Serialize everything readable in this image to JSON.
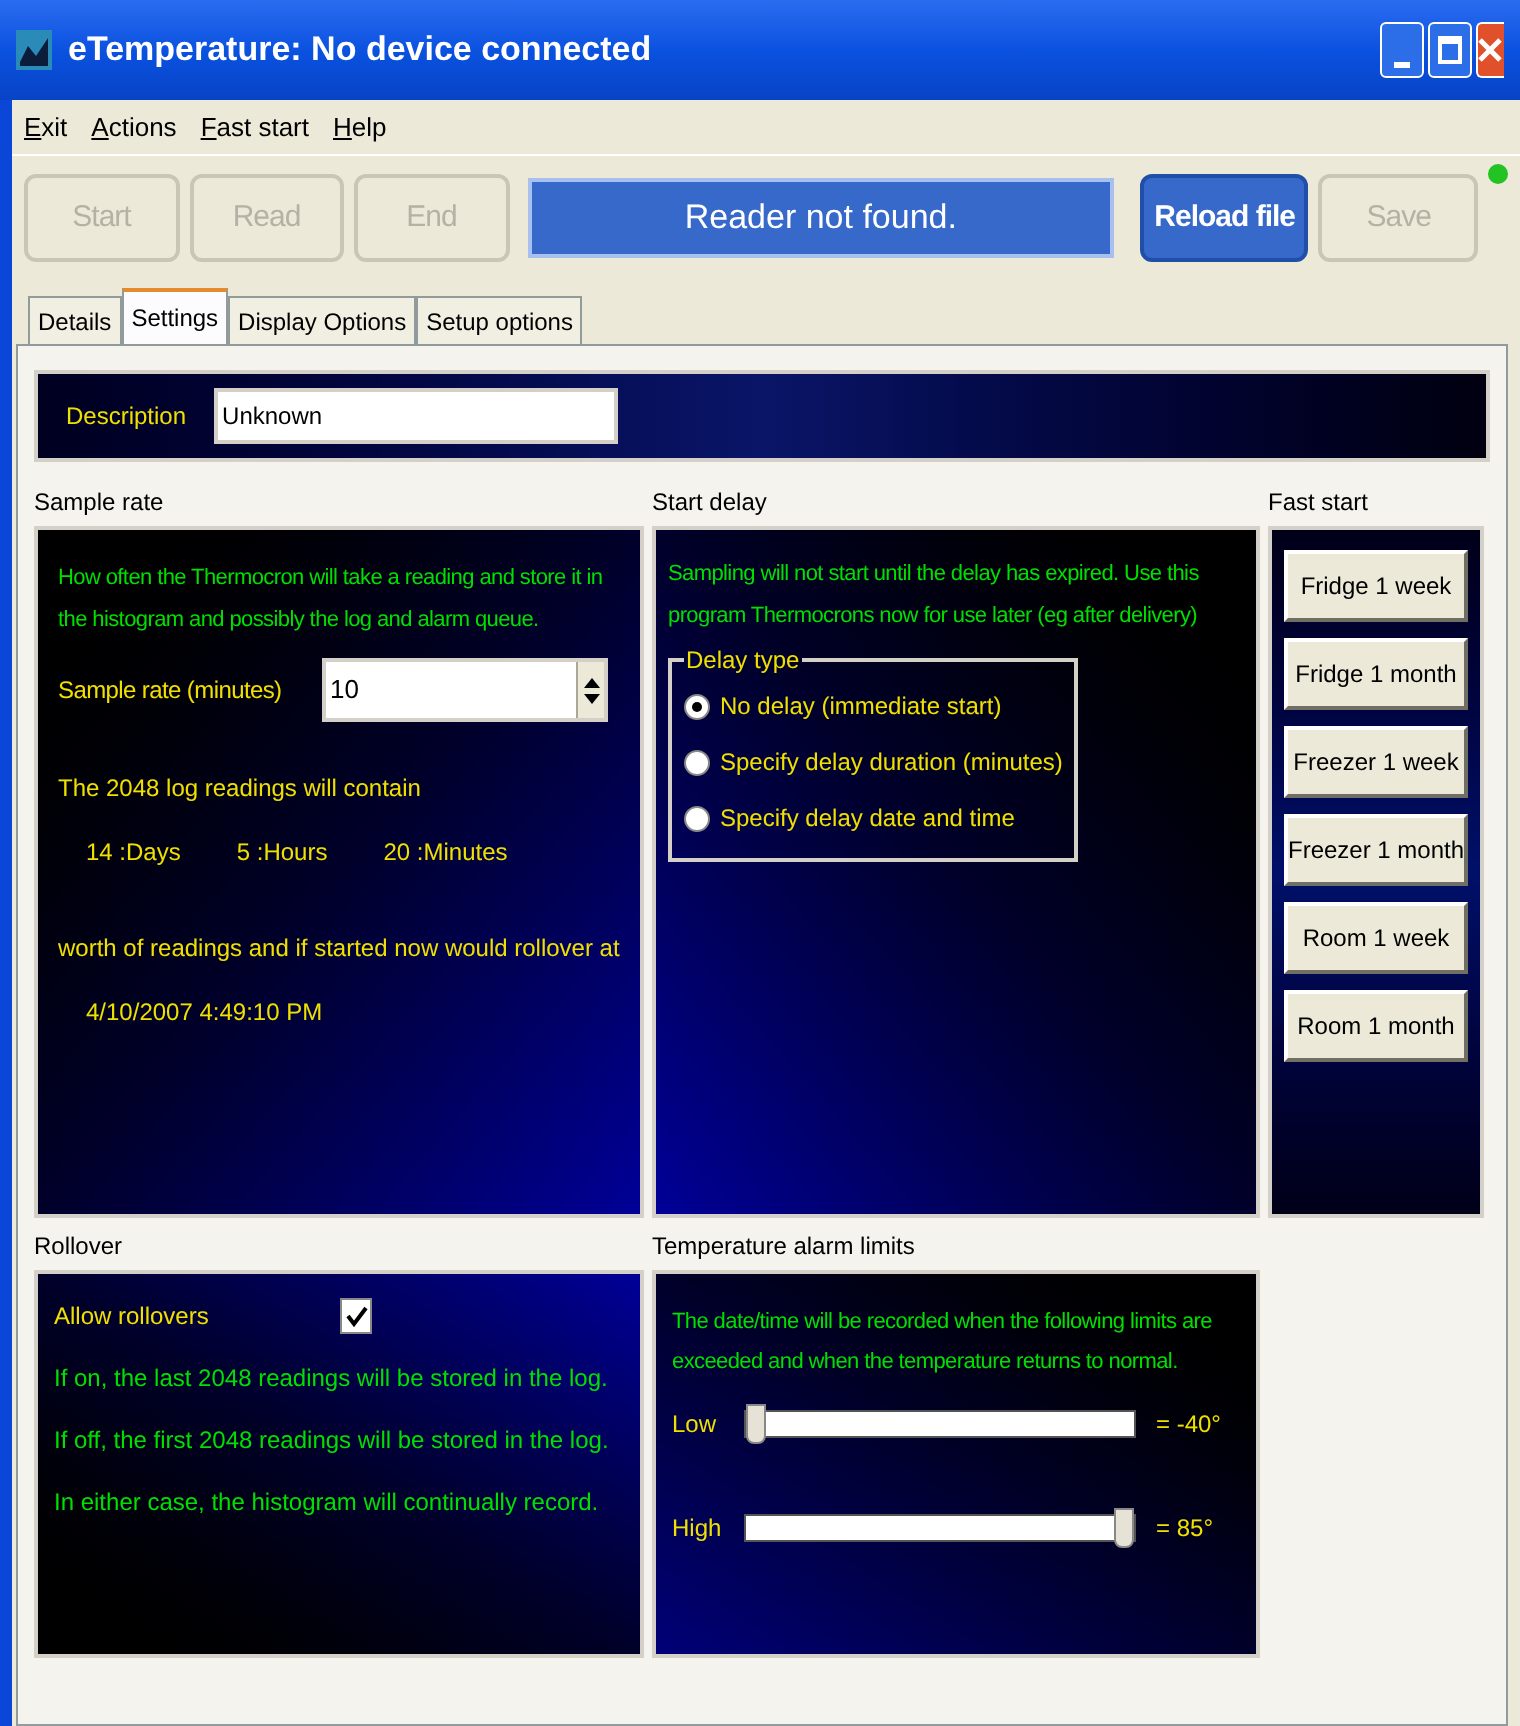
{
  "window": {
    "title": "eTemperature: No device connected"
  },
  "menu": [
    "Exit",
    "Actions",
    "Fast start",
    "Help"
  ],
  "toolbar": {
    "buttons_left": [
      {
        "label": "Start",
        "disabled": true
      },
      {
        "label": "Read",
        "disabled": true
      },
      {
        "label": "End",
        "disabled": true
      }
    ],
    "status": "Reader not found.",
    "buttons_right": [
      {
        "label": "Reload file",
        "disabled": false
      },
      {
        "label": "Save",
        "disabled": true
      }
    ],
    "indicator": {
      "on": true
    }
  },
  "tabs": [
    {
      "label": "Details",
      "selected": false
    },
    {
      "label": "Settings",
      "selected": true
    },
    {
      "label": "Display Options",
      "selected": false
    },
    {
      "label": "Setup options",
      "selected": false
    }
  ],
  "description": {
    "label": "Description",
    "value": "Unknown"
  },
  "sample_rate": {
    "title": "Sample rate",
    "intro": "How often the Thermocron will take a reading and store it in the histogram and possibly the log and alarm queue.",
    "field_label": "Sample rate (minutes)",
    "value": "10",
    "summary": "The 2048 log readings will contain",
    "durations": [
      "14 :Days",
      "5 :Hours",
      "20 :Minutes"
    ],
    "rollover_text": "worth of readings and if started now would rollover at",
    "rollover_time": "4/10/2007 4:49:10 PM"
  },
  "start_delay": {
    "title": "Start delay",
    "intro": "Sampling will not start until the delay has expired. Use this program Thermocrons now for use later (eg after delivery)",
    "group_title": "Delay type",
    "options": [
      {
        "label": "No delay (immediate start)",
        "selected": true
      },
      {
        "label": "Specify delay duration (minutes)",
        "selected": false
      },
      {
        "label": "Specify delay date and time",
        "selected": false
      }
    ]
  },
  "fast_start": {
    "title": "Fast start",
    "buttons": [
      "Fridge 1 week",
      "Fridge 1 month",
      "Freezer 1 week",
      "Freezer 1 month",
      "Room 1 week",
      "Room 1 month"
    ]
  },
  "rollover": {
    "title": "Rollover",
    "checkbox": {
      "label": "Allow rollovers",
      "checked": true
    },
    "notes": [
      "If on, the last 2048 readings will be stored in the log.",
      "If off, the first 2048 readings will be stored in the log.",
      "In either case, the histogram will continually record."
    ]
  },
  "alarm_limits": {
    "title": "Temperature alarm limits",
    "intro": "The date/time will be recorded when the following limits are exceeded and when the temperature returns to normal.",
    "sliders": [
      {
        "label": "Low",
        "level": 0,
        "reading": "= -40°"
      },
      {
        "label": "High",
        "level": 1,
        "reading": "= 85°"
      }
    ]
  }
}
